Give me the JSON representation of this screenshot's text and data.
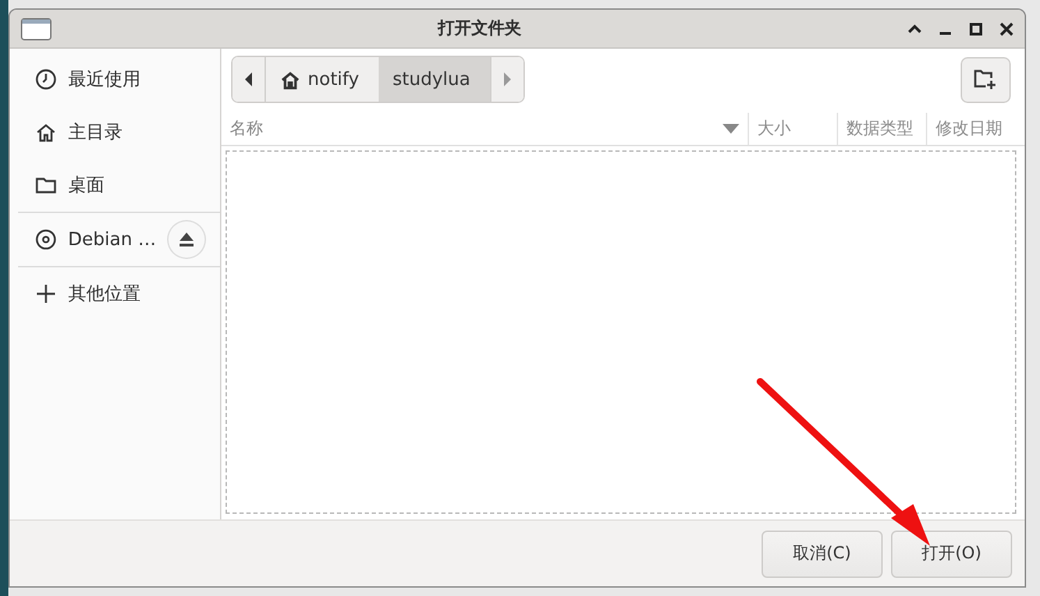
{
  "window": {
    "title": "打开文件夹"
  },
  "sidebar": {
    "items": [
      {
        "kind": "recent",
        "label": "最近使用"
      },
      {
        "kind": "home",
        "label": "主目录"
      },
      {
        "kind": "desktop",
        "label": "桌面"
      },
      {
        "kind": "drive",
        "label": "Debian …"
      },
      {
        "kind": "other",
        "label": "其他位置"
      }
    ]
  },
  "path_bar": {
    "segments": [
      {
        "kind": "home",
        "label": "notify",
        "selected": false
      },
      {
        "kind": "folder",
        "label": "studylua",
        "selected": true
      }
    ]
  },
  "columns": [
    {
      "label": "名称",
      "sorted": true
    },
    {
      "label": "大小",
      "sorted": false
    },
    {
      "label": "数据类型",
      "sorted": false
    },
    {
      "label": "修改日期",
      "sorted": false
    }
  ],
  "buttons": [
    {
      "label": "取消(C)"
    },
    {
      "label": "打开(O)"
    }
  ]
}
